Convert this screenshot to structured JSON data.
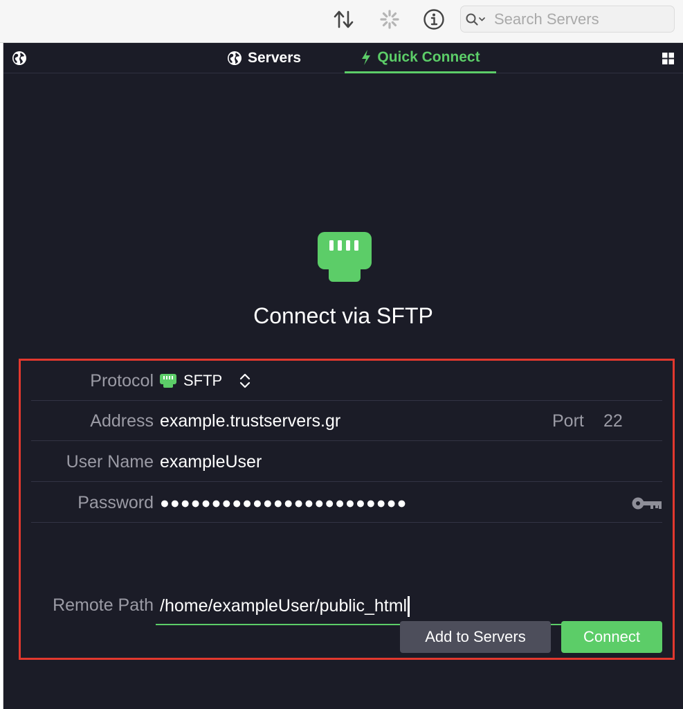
{
  "toolbar": {
    "sort_icon": "sort-arrows-icon",
    "activity_icon": "spinner-icon",
    "info_icon": "info-icon",
    "search_placeholder": "Search Servers"
  },
  "tabs": [
    {
      "label": "Servers",
      "icon": "globe-icon",
      "active": false
    },
    {
      "label": "Quick Connect",
      "icon": "lightning-icon",
      "active": true
    }
  ],
  "hero": {
    "icon": "ethernet-port-icon",
    "heading": "Connect via SFTP"
  },
  "form": {
    "protocol": {
      "label": "Protocol",
      "value": "SFTP"
    },
    "address": {
      "label": "Address",
      "value": "example.trustservers.gr",
      "port_label": "Port",
      "port_value": "22"
    },
    "username": {
      "label": "User Name",
      "value": "exampleUser"
    },
    "password": {
      "label": "Password",
      "masked": "●●●●●●●●●●●●●●●●●●●●●●●●"
    },
    "remote_path": {
      "label": "Remote Path",
      "value": "/home/exampleUser/public_html"
    }
  },
  "buttons": {
    "add_to_servers": "Add to Servers",
    "connect": "Connect"
  },
  "colors": {
    "accent": "#5ccd68",
    "panel_bg": "#1b1c27",
    "highlight_border": "#e2382e",
    "secondary_button": "#4d4e5b"
  }
}
